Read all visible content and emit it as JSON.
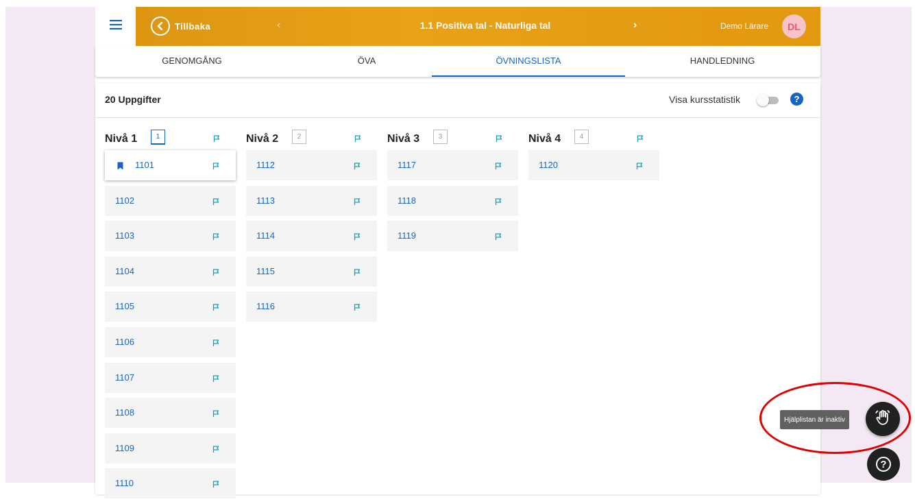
{
  "header": {
    "back_label": "Tillbaka",
    "prev_symbol": "‹",
    "title": "1.1 Positiva tal - Naturliga tal",
    "next_symbol": "›",
    "user_name": "Demo Lärare",
    "avatar_initials": "DL"
  },
  "tabs": [
    {
      "label": "GENOMGÅNG",
      "active": false
    },
    {
      "label": "ÖVA",
      "active": false
    },
    {
      "label": "ÖVNINGSLISTA",
      "active": true
    },
    {
      "label": "HANDLEDNING",
      "active": false
    }
  ],
  "list": {
    "count_label": "20 Uppgifter",
    "stat_toggle_label": "Visa kursstatistik",
    "stat_toggle_on": false,
    "help_symbol": "?"
  },
  "levels": [
    {
      "title": "Nivå 1",
      "badge": "1",
      "active": true,
      "items": [
        "1101",
        "1102",
        "1103",
        "1104",
        "1105",
        "1106",
        "1107",
        "1108",
        "1109",
        "1110"
      ],
      "selected": "1101"
    },
    {
      "title": "Nivå 2",
      "badge": "2",
      "active": false,
      "items": [
        "1112",
        "1113",
        "1114",
        "1115",
        "1116"
      ]
    },
    {
      "title": "Nivå 3",
      "badge": "3",
      "active": false,
      "items": [
        "1117",
        "1118",
        "1119"
      ]
    },
    {
      "title": "Nivå 4",
      "badge": "4",
      "active": false,
      "items": [
        "1120"
      ]
    }
  ],
  "floating": {
    "tooltip": "Hjälplistan är inaktiv",
    "help_symbol": "?"
  },
  "colors": {
    "header_orange": "#e49c14",
    "accent_blue": "#1565c0",
    "flag_teal": "#17a2b8",
    "page_bg": "#f3e8f3",
    "annotation_red": "#e00000"
  }
}
